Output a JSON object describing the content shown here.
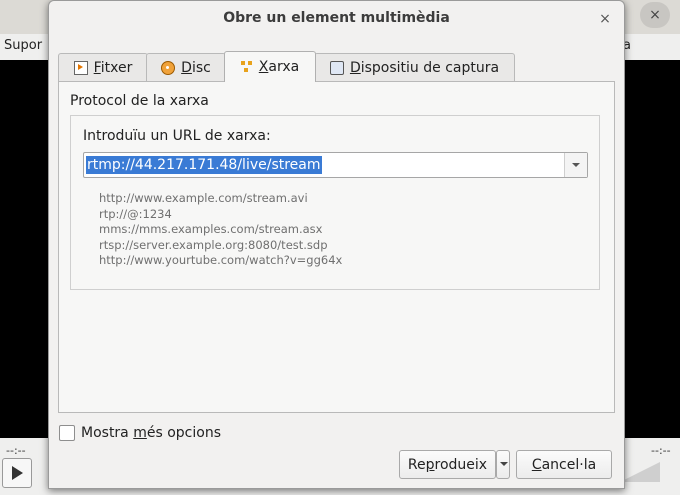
{
  "background_window": {
    "menu_left": "Supor",
    "menu_right": "a",
    "close_glyph": "×",
    "time_left": "--:--",
    "time_right": "--:--"
  },
  "dialog": {
    "title": "Obre un element multimèdia",
    "close_glyph": "×",
    "tabs": [
      {
        "label_pre": "",
        "label_ul": "F",
        "label_post": "itxer",
        "icon": "file-icon",
        "active": false
      },
      {
        "label_pre": "",
        "label_ul": "D",
        "label_post": "isc",
        "icon": "disc-icon",
        "active": false
      },
      {
        "label_pre": "",
        "label_ul": "X",
        "label_post": "arxa",
        "icon": "network-icon",
        "active": true
      },
      {
        "label_pre": "",
        "label_ul": "D",
        "label_post": "ispositiu de captura",
        "icon": "capture-device-icon",
        "active": false
      }
    ],
    "network": {
      "section_title": "Protocol de la xarxa",
      "url_label": "Introduïu un URL de xarxa:",
      "url_value": "rtmp://44.217.171.48/live/stream",
      "examples": [
        "http://www.example.com/stream.avi",
        "rtp://@:1234",
        "mms://mms.examples.com/stream.asx",
        "rtsp://server.example.org:8080/test.sdp",
        "http://www.yourtube.com/watch?v=gg64x"
      ]
    },
    "more_options": {
      "pre": "Mostra ",
      "ul": "m",
      "post": "és opcions",
      "checked": false
    },
    "buttons": {
      "play": {
        "pre": "Re",
        "ul": "p",
        "post": "rodueix"
      },
      "cancel": {
        "pre": "",
        "ul": "C",
        "post": "ancel·la"
      }
    }
  }
}
